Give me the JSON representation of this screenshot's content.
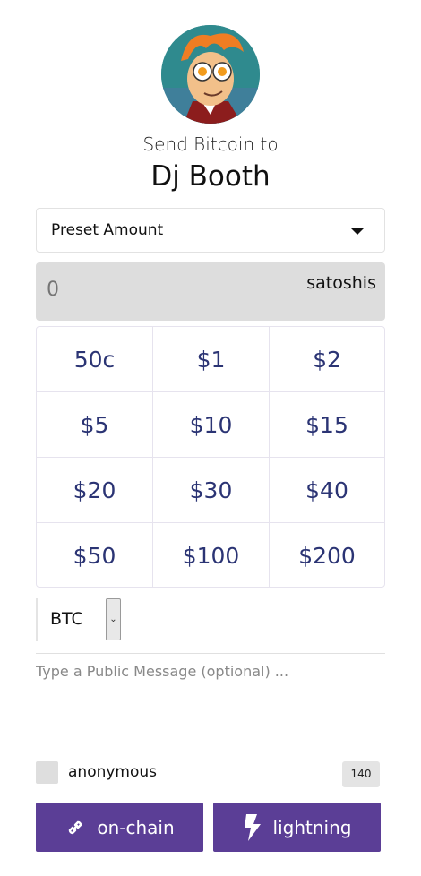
{
  "header": {
    "send_label": "Send Bitcoin to",
    "recipient": "Dj Booth",
    "avatar_icon": "cartoon-avatar-icon"
  },
  "preset": {
    "select_label": "Preset Amount",
    "caret_icon": "caret-down-icon"
  },
  "amount": {
    "value": "0",
    "unit": "satoshis"
  },
  "preset_amounts": [
    "50c",
    "$1",
    "$2",
    "$5",
    "$10",
    "$15",
    "$20",
    "$30",
    "$40",
    "$50",
    "$100",
    "$200"
  ],
  "currency": {
    "selected": "BTC",
    "toggle_glyph": "⌄"
  },
  "message": {
    "placeholder": "Type a Public Message (optional) ..."
  },
  "options": {
    "anonymous_label": "anonymous",
    "char_count": "140"
  },
  "actions": {
    "onchain_label": "on-chain",
    "onchain_icon": "link-icon",
    "lightning_label": "lightning",
    "lightning_icon": "lightning-bolt-icon"
  },
  "colors": {
    "accent": "#5b3e96",
    "preset_text": "#2b3474",
    "amount_bg": "#dddddd"
  }
}
